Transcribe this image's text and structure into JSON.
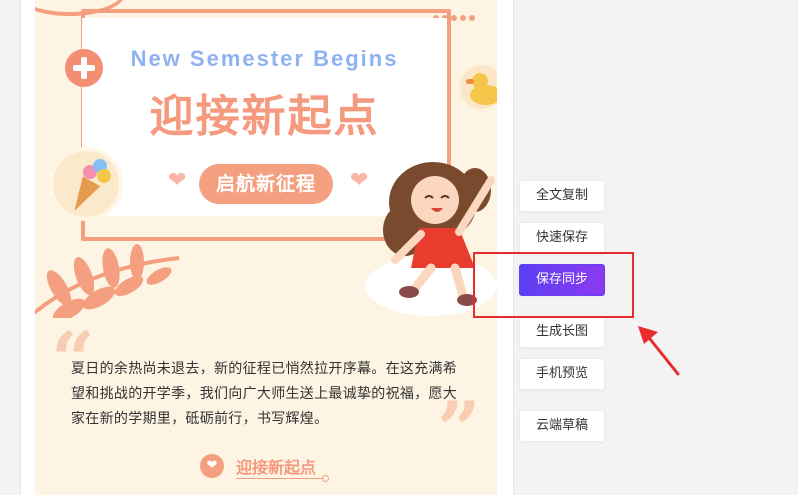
{
  "article": {
    "subtitle": "New Semester Begins",
    "headline": "迎接新起点",
    "pill_label": "启航新征程",
    "body_text": "夏日的余热尚未退去，新的征程已悄然拉开序幕。在这充满希望和挑战的开学季，我们向广大师生送上最诚挚的祝福，愿大家在新的学期里，砥砺前行，书写辉煌。",
    "footer_label": "迎接新起点",
    "quote_open": "“",
    "quote_close": "”"
  },
  "actions": [
    {
      "label": "全文复制"
    },
    {
      "label": "快速保存"
    },
    {
      "label": "保存同步"
    },
    {
      "label": "生成长图"
    },
    {
      "label": "手机预览"
    },
    {
      "label": "云端草稿"
    }
  ],
  "colors": {
    "accent_orange": "#f59f81",
    "accent_blue": "#8fb2f1",
    "primary_button_start": "#5b3ff2",
    "primary_button_end": "#8c3af2",
    "highlight_red": "#e82b2b",
    "article_bg": "#fdf4e4"
  },
  "icons": {
    "plus_badge": "plus-icon",
    "duck": "duck-icon",
    "icecream": "ice-cream-icon",
    "footer": "heart-icon",
    "arrow": "arrow-icon"
  }
}
